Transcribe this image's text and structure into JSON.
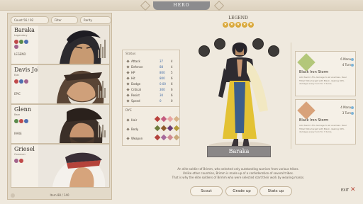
{
  "header": {
    "title": "HERO"
  },
  "list": {
    "filters": [
      "Count 56 / 92",
      "Filter",
      "Rarity"
    ],
    "footer": "Item 88 / 140",
    "heroes": [
      {
        "name": "Baraka",
        "sub": "Legendary",
        "stat": "LEGEND"
      },
      {
        "name": "Davis Johnson",
        "sub": "Epic",
        "stat": "EPIC"
      },
      {
        "name": "Glenn",
        "sub": "Rare",
        "stat": "RARE"
      },
      {
        "name": "Griesel",
        "sub": "Common",
        "stat": ""
      }
    ]
  },
  "stats": {
    "title": "Status",
    "rows": [
      {
        "label": "Attack",
        "v1": "37",
        "v2": "4"
      },
      {
        "label": "Defense",
        "v1": "88",
        "v2": "4"
      },
      {
        "label": "HP",
        "v1": "800",
        "v2": "5"
      },
      {
        "label": "Hit",
        "v1": "800",
        "v2": "6"
      },
      {
        "label": "Dodge",
        "v1": "0.00",
        "v2": "6"
      },
      {
        "label": "Critical",
        "v1": "300",
        "v2": "6"
      },
      {
        "label": "Resist",
        "v1": "30",
        "v2": "6"
      },
      {
        "label": "Speed",
        "v1": "0",
        "v2": "0"
      }
    ]
  },
  "dye": {
    "title": "DYE",
    "rows": [
      {
        "label": "Hair",
        "colors": [
          "#b9413b",
          "#c45b7e",
          "#e7a3a1",
          "#d7b389"
        ]
      },
      {
        "label": "Body",
        "colors": [
          "#6d7b3c",
          "#8d5a2b",
          "#6b3c74",
          "#b59a3a"
        ]
      },
      {
        "label": "Weapon",
        "colors": [
          "#b3423c",
          "#a56a9b",
          "#cf8a92",
          "#c9a97c"
        ]
      }
    ]
  },
  "hero": {
    "rank": "LEGEND",
    "stars": 5,
    "name": "Baraka",
    "description": [
      "An elite soldier of Brimm, who selected only outstanding warriors from various tribes.",
      "Unlike other countries, Brimm is made up of a confederation of several tribes.",
      "That is why the elite soldiers of Brimm who were selected start their work by wearing masks."
    ]
  },
  "actions": {
    "scout": "Scout",
    "grade_up": "Grade up",
    "stats_up": "Stats up",
    "exit": "EXIT"
  },
  "skills": [
    {
      "title": "Black Iron Storm",
      "cost1": "6 Mana",
      "cost2": "4 Turn",
      "text": "Add Swim 15% damage to all enemies. Deal Tribal Mote target with Black, dealing 90% damage every turn for 3 turns.",
      "color": "#b3c77a"
    },
    {
      "title": "Black Iron Storm",
      "cost1": "4 Mana",
      "cost2": "3 Turn",
      "text": "Add Swim 15% damage to all enemies. Deal Tribal Mote target with Black, dealing 90% damage every turn for 3 turns.",
      "color": "#d8a27a"
    }
  ],
  "colors": {
    "accent": "#3f6aa6",
    "banner": "#8a8787",
    "gold": "#d9a83c"
  }
}
